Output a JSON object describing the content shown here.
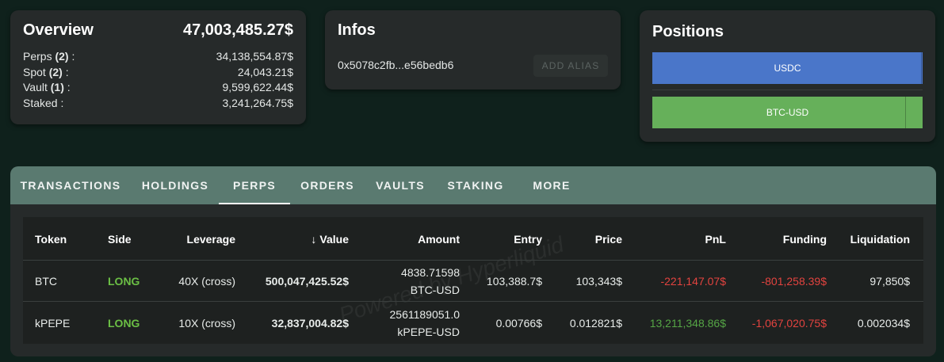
{
  "overview": {
    "title": "Overview",
    "total": "47,003,485.27$",
    "rows": [
      {
        "label": "Perps",
        "count": "(2)",
        "suffix": ":",
        "value": "34,138,554.87$"
      },
      {
        "label": "Spot",
        "count": "(2)",
        "suffix": ":",
        "value": "24,043.21$"
      },
      {
        "label": "Vault",
        "count": "(1)",
        "suffix": ":",
        "value": "9,599,622.44$"
      },
      {
        "label": "Staked",
        "count": "",
        "suffix": ":",
        "value": "3,241,264.75$"
      }
    ]
  },
  "infos": {
    "title": "Infos",
    "address": "0x5078c2fb...e56bedb6",
    "alias_button": "ADD ALIAS"
  },
  "positions": {
    "title": "Positions",
    "bars": [
      {
        "label": "USDC",
        "color": "#4a76c9",
        "fraction": 0.995
      },
      {
        "label": "BTC-USD",
        "color": "#66b05a",
        "fraction": 0.935
      }
    ]
  },
  "tabs": {
    "items": [
      "TRANSACTIONS",
      "HOLDINGS",
      "PERPS",
      "ORDERS",
      "VAULTS",
      "STAKING",
      "MORE"
    ],
    "active": "PERPS"
  },
  "table": {
    "headers": {
      "token": "Token",
      "side": "Side",
      "leverage": "Leverage",
      "value_arrow": "↓",
      "value": "Value",
      "amount": "Amount",
      "entry": "Entry",
      "price": "Price",
      "pnl": "PnL",
      "funding": "Funding",
      "liquidation": "Liquidation"
    },
    "rows": [
      {
        "token": "BTC",
        "side": "LONG",
        "leverage": "40X (cross)",
        "value": "500,047,425.52$",
        "amount_qty": "4838.71598",
        "amount_unit": "BTC-USD",
        "entry": "103,388.7$",
        "price": "103,343$",
        "pnl": "-221,147.07$",
        "funding": "-801,258.39$",
        "liquidation": "97,850$"
      },
      {
        "token": "kPEPE",
        "side": "LONG",
        "leverage": "10X (cross)",
        "value": "32,837,004.82$",
        "amount_qty": "2561189051.0",
        "amount_unit": "kPEPE-USD",
        "entry": "0.00766$",
        "price": "0.012821$",
        "pnl": "13,211,348.86$",
        "funding": "-1,067,020.75$",
        "liquidation": "0.002034$"
      }
    ],
    "watermark": "Powered by Hyperliquid"
  },
  "colors": {
    "background": "#0f211c",
    "card": "#262a2a",
    "tabbar": "#5a7a70",
    "long": "#6bbf45",
    "negative": "#e2433f",
    "positive": "#55a545"
  }
}
